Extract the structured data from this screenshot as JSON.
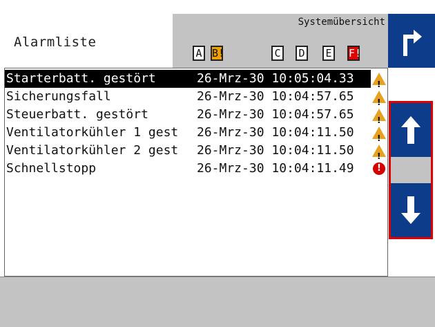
{
  "header": {
    "title": "Alarmliste",
    "system_overview_label": "Systemübersicht",
    "system_boxes": [
      {
        "label": "A",
        "state": "normal"
      },
      {
        "label": "B!",
        "state": "warning"
      },
      {
        "label": "C",
        "state": "normal"
      },
      {
        "label": "D",
        "state": "normal"
      },
      {
        "label": "E",
        "state": "normal"
      },
      {
        "label": "F!",
        "state": "error"
      }
    ]
  },
  "alarms": [
    {
      "name": "Starterbatt. gestört",
      "date": "26-Mrz-30",
      "time": "10:05:04.33",
      "severity": "warning",
      "selected": true
    },
    {
      "name": "Sicherungsfall",
      "date": "26-Mrz-30",
      "time": "10:04:57.65",
      "severity": "warning",
      "selected": false
    },
    {
      "name": "Steuerbatt. gestört",
      "date": "26-Mrz-30",
      "time": "10:04:57.65",
      "severity": "warning",
      "selected": false
    },
    {
      "name": "Ventilatorkühler 1 gest",
      "date": "26-Mrz-30",
      "time": "10:04:11.50",
      "severity": "warning",
      "selected": false
    },
    {
      "name": "Ventilatorkühler 2 gest",
      "date": "26-Mrz-30",
      "time": "10:04:11.50",
      "severity": "warning",
      "selected": false
    },
    {
      "name": "Schnellstopp",
      "date": "26-Mrz-30",
      "time": "10:04:11.49",
      "severity": "error",
      "selected": false
    }
  ],
  "navigation": {
    "exit_icon": "turn-up-right-arrow-icon",
    "up_icon": "arrow-up-icon",
    "down_icon": "arrow-down-icon",
    "highlight_color": "#e00000",
    "button_color": "#0d3d8a"
  }
}
